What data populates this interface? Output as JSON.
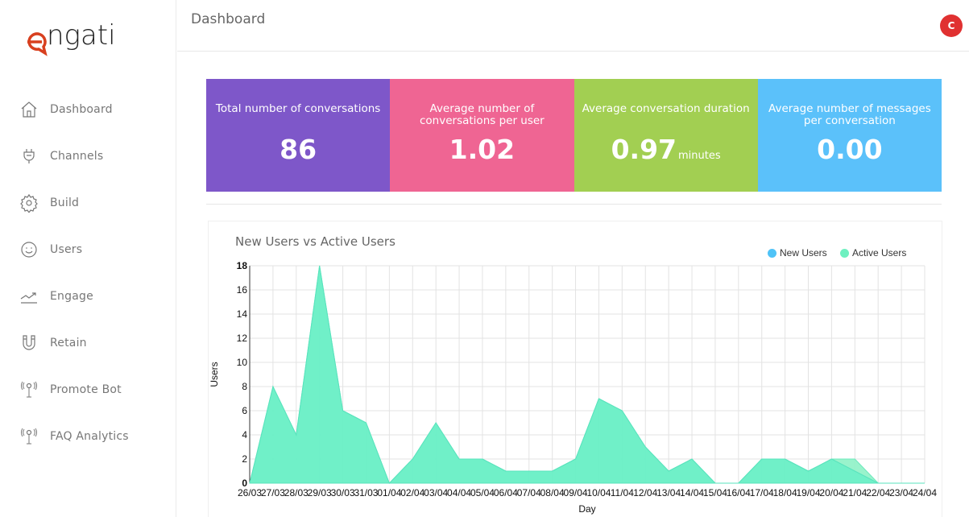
{
  "brand": "engati",
  "sidebar": {
    "items": [
      {
        "label": "Dashboard",
        "icon": "home-icon"
      },
      {
        "label": "Channels",
        "icon": "plug-icon"
      },
      {
        "label": "Build",
        "icon": "gear-icon"
      },
      {
        "label": "Users",
        "icon": "smiley-icon"
      },
      {
        "label": "Engage",
        "icon": "trend-icon"
      },
      {
        "label": "Retain",
        "icon": "magnet-icon"
      },
      {
        "label": "Promote Bot",
        "icon": "antenna-icon"
      },
      {
        "label": "FAQ Analytics",
        "icon": "antenna-icon"
      }
    ]
  },
  "header": {
    "title": "Dashboard",
    "avatar": "C",
    "avatar_color": "#e03131"
  },
  "cards": [
    {
      "label": "Total number of conversations",
      "value": "86",
      "unit": "",
      "color": "#7e57c9"
    },
    {
      "label": "Average number of conversations per user",
      "value": "1.02",
      "unit": "",
      "color": "#ef6593"
    },
    {
      "label": "Average conversation duration",
      "value": "0.97",
      "unit": "minutes",
      "color": "#a2cf52"
    },
    {
      "label": "Average number of messages per conversation",
      "value": "0.00",
      "unit": "",
      "color": "#5bc1fa"
    }
  ],
  "chart_data": {
    "type": "area",
    "title": "New Users vs Active Users",
    "xlabel": "Day",
    "ylabel": "Users",
    "ylim": [
      0,
      18
    ],
    "yticks": [
      0,
      2,
      4,
      6,
      8,
      10,
      12,
      14,
      16,
      18
    ],
    "grid": true,
    "legend": "top-right",
    "categories": [
      "26/03",
      "27/03",
      "28/03",
      "29/03",
      "30/03",
      "31/03",
      "01/04",
      "02/04",
      "03/04",
      "04/04",
      "05/04",
      "06/04",
      "07/04",
      "08/04",
      "09/04",
      "10/04",
      "11/04",
      "12/04",
      "13/04",
      "14/04",
      "15/04",
      "16/04",
      "17/04",
      "18/04",
      "19/04",
      "20/04",
      "21/04",
      "22/04",
      "23/04",
      "24/04"
    ],
    "series": [
      {
        "name": "Active Users",
        "color": "#8ef2c6",
        "values": [
          0,
          8,
          4,
          18,
          6,
          5,
          0,
          2,
          5,
          2,
          2,
          1,
          1,
          1,
          2,
          7,
          6,
          3,
          1,
          2,
          0,
          0,
          2,
          2,
          1,
          2,
          2,
          0,
          0,
          0
        ]
      },
      {
        "name": "New Users",
        "color": "#4fc3f7",
        "values": [
          0,
          8,
          4,
          18,
          6,
          5,
          0,
          2,
          5,
          2,
          2,
          1,
          1,
          1,
          2,
          7,
          6,
          3,
          1,
          2,
          0,
          0,
          2,
          2,
          1,
          2,
          1,
          0,
          0,
          0
        ]
      }
    ]
  }
}
